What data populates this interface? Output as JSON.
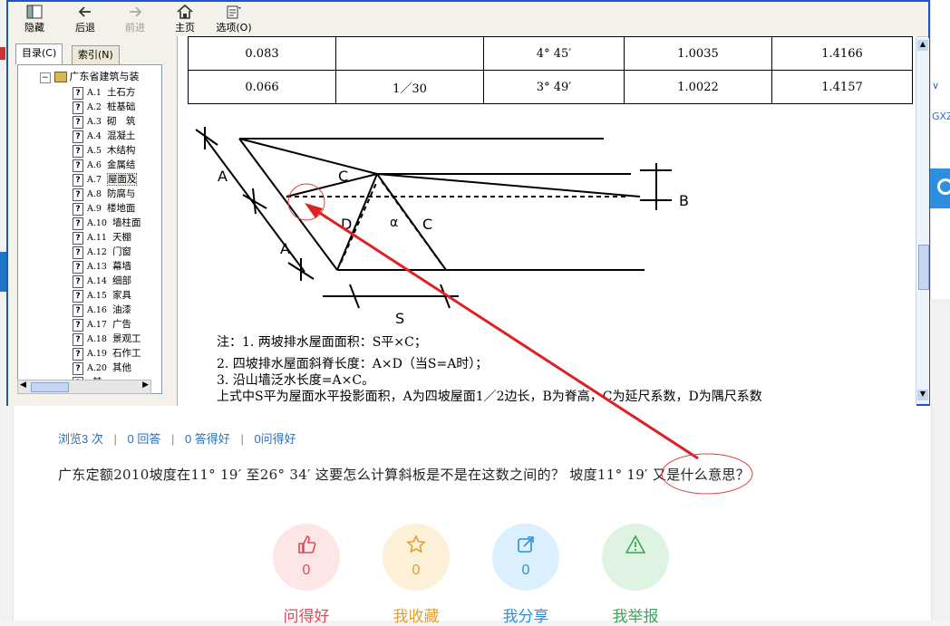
{
  "toolbar": {
    "hide": "隐藏",
    "back": "后退",
    "forward": "前进",
    "home": "主页",
    "options": "选项(O)"
  },
  "left_tabs": {
    "contents": "目录(C)",
    "index": "索引(N)"
  },
  "tree": {
    "root": "广东省建筑与装",
    "items": [
      {
        "code": "A.1",
        "label": "土石方"
      },
      {
        "code": "A.2",
        "label": "桩基础"
      },
      {
        "code": "A.3",
        "label": "砌　筑"
      },
      {
        "code": "A.4",
        "label": "混凝土"
      },
      {
        "code": "A.5",
        "label": "木结构"
      },
      {
        "code": "A.6",
        "label": "金属结"
      },
      {
        "code": "A.7",
        "label": "屋面及"
      },
      {
        "code": "A.8",
        "label": "防腐与"
      },
      {
        "code": "A.9",
        "label": "楼地面"
      },
      {
        "code": "A.10",
        "label": "墙柱面"
      },
      {
        "code": "A.11",
        "label": "天棚"
      },
      {
        "code": "A.12",
        "label": "门窗"
      },
      {
        "code": "A.13",
        "label": "幕墙"
      },
      {
        "code": "A.14",
        "label": "细部"
      },
      {
        "code": "A.15",
        "label": "家具"
      },
      {
        "code": "A.16",
        "label": "油漆"
      },
      {
        "code": "A.17",
        "label": "广告"
      },
      {
        "code": "A.18",
        "label": "景观工"
      },
      {
        "code": "A.19",
        "label": "石作工"
      },
      {
        "code": "A.20",
        "label": "其他"
      },
      {
        "code": "",
        "label": "其"
      }
    ],
    "selected_index": 6
  },
  "table": {
    "rows": [
      [
        "0.083",
        "",
        "4° 45′",
        "1.0035",
        "1.4166"
      ],
      [
        "0.066",
        "1／30",
        "3° 49′",
        "1.0022",
        "1.4157"
      ]
    ]
  },
  "diagram_labels": {
    "A_top": "A",
    "A_bottom": "A",
    "C_top": "C",
    "D": "D",
    "alpha": "α",
    "C_right": "C",
    "B": "B",
    "S": "S"
  },
  "notes": {
    "line1": "注：1. 两坡排水屋面面积：S平×C；",
    "line2": "2. 四坡排水屋面斜脊长度：A×D（当S=A时）；",
    "line3": "3. 沿山墙泛水长度=A×C。",
    "line4": "上式中S平为屋面水平投影面积，A为四坡屋面1／2边长，B为脊高，C为延尺系数，D为隅尺系数"
  },
  "stats": {
    "views": "浏览3 次",
    "answers": "0 回答",
    "good_answers": "0 答得好",
    "good_questions": "0问得好",
    "sep": "|"
  },
  "question": "广东定额2010坡度在11° 19′ 至26° 34′ 这要怎么计算斜板是不是在这数之间的？ 坡度11° 19′ 又是什么意思？",
  "actions": [
    {
      "label": "问得好",
      "count": "0",
      "icon": "thumbs-up-icon",
      "color": "#e04a5a",
      "bg": "#fde6e6"
    },
    {
      "label": "我收藏",
      "count": "0",
      "icon": "star-icon",
      "color": "#e0a030",
      "bg": "#fdf0d8"
    },
    {
      "label": "我分享",
      "count": "0",
      "icon": "share-icon",
      "color": "#2f8fd6",
      "bg": "#dceffc"
    },
    {
      "label": "我举报",
      "count": "",
      "icon": "warning-icon",
      "color": "#3aa65a",
      "bg": "#dff3e3"
    }
  ],
  "bg_fragments": {
    "right_text": "GXZ"
  }
}
